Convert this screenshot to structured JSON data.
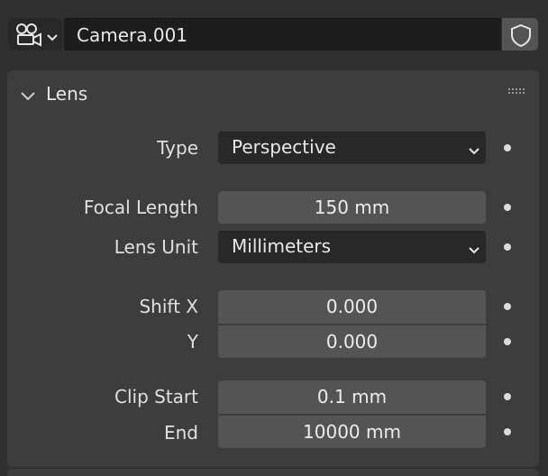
{
  "header": {
    "datablock_type_icon": "camera-data-icon",
    "datablock_name": "Camera.001",
    "fake_user_icon": "shield-icon"
  },
  "panel": {
    "title": "Lens",
    "collapse_icon": "chevron-down-icon",
    "grip_icon": "drag-grip-icon",
    "rows": {
      "type": {
        "label": "Type",
        "value": "Perspective"
      },
      "focal_length": {
        "label": "Focal Length",
        "value": "150 mm"
      },
      "lens_unit": {
        "label": "Lens Unit",
        "value": "Millimeters"
      },
      "shift_x": {
        "label": "Shift X",
        "value": "0.000"
      },
      "shift_y": {
        "label": "Y",
        "value": "0.000"
      },
      "clip_start": {
        "label": "Clip Start",
        "value": "0.1 mm"
      },
      "clip_end": {
        "label": "End",
        "value": "10000 mm"
      }
    }
  },
  "colors": {
    "background": "#303030",
    "panel": "#3d3d3d",
    "field": "#545454",
    "dropdown": "#282828",
    "text": "#e6e6e6"
  }
}
